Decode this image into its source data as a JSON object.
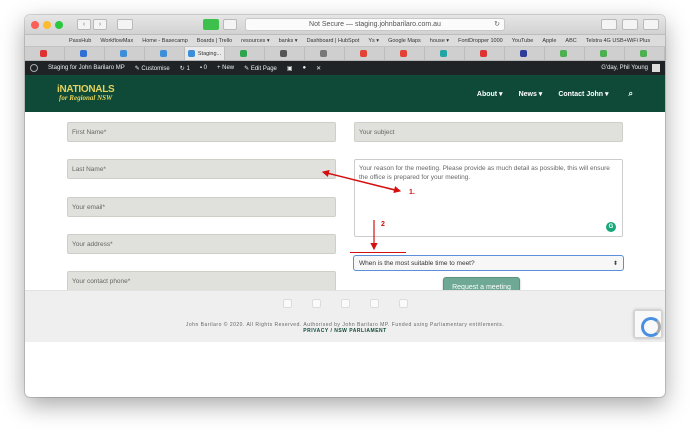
{
  "browser": {
    "url_text": "Not Secure — staging.johnbarilaro.com.au",
    "bookmarks": [
      "PassHub",
      "WorkflowMax",
      "Home - Basecamp",
      "Boards | Trello",
      "resources ▾",
      "banks ▾",
      "Dashboard | HubSpot",
      "Ys ▾",
      "Google Maps",
      "house ▾",
      "FontDropper 1000",
      "YouTube",
      "Apple",
      "ABC",
      "Telstra 4G USB+WiFi Plus"
    ],
    "active_tab": "Staging..."
  },
  "admin_bar": {
    "site_name": "Staging for John Barilaro MP",
    "customise": "Customise",
    "updates_count": "1",
    "comments_count": "0",
    "new_label": "+ New",
    "edit_page": "Edit Page",
    "greeting": "G'day, Phil Young"
  },
  "site": {
    "logo_line1": "iNATIONALS",
    "logo_line2": "for Regional NSW",
    "nav": [
      "About ▾",
      "News ▾",
      "Contact John ▾"
    ]
  },
  "form": {
    "first_name_placeholder": "First Name*",
    "last_name_placeholder": "Last Name*",
    "email_placeholder": "Your email*",
    "address_placeholder": "Your address*",
    "phone_placeholder": "Your contact phone*",
    "subject_placeholder": "Your subject",
    "reason_placeholder": "Your reason for the meeting. Please provide as much detail as possible, this will ensure the office is prepared for your meeting.",
    "time_select_value": "When is the most suitable time to meet?",
    "submit_label": "Request a meeting"
  },
  "annotations": {
    "label1": "1.",
    "label2": "2"
  },
  "footer": {
    "copyright": "John Barilaro © 2020. All Rights Reserved. Authorised by John Barilaro MP. Funded using Parliamentary entitlements.",
    "links": "PRIVACY / NSW PARLIAMENT"
  }
}
